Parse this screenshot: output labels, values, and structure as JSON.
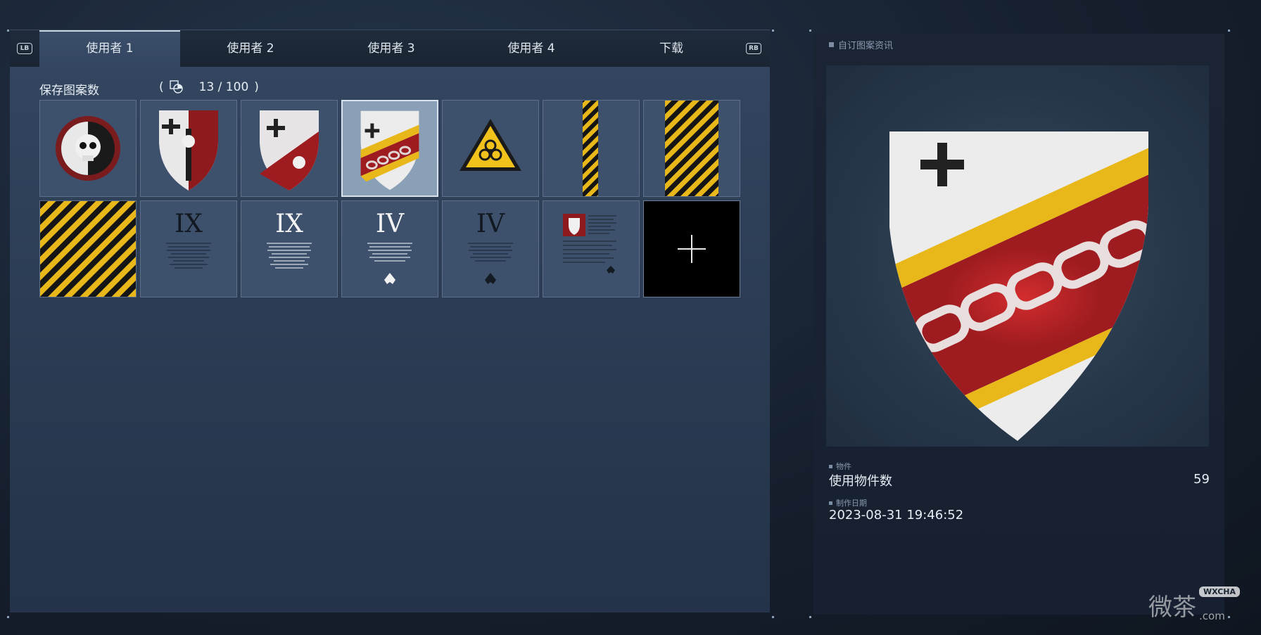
{
  "tabs": {
    "lb": "LB",
    "rb": "RB",
    "items": [
      "使用者 1",
      "使用者 2",
      "使用者 3",
      "使用者 4",
      "下载"
    ],
    "active_index": 0
  },
  "saved": {
    "label": "保存图案数",
    "open_paren": "(",
    "count": "13 / 100",
    "close_paren": ")"
  },
  "grid": {
    "items": [
      {
        "kind": "skull-gear-emblem"
      },
      {
        "kind": "shield-cross-skull"
      },
      {
        "kind": "shield-cross-red-skull"
      },
      {
        "kind": "shield-chain",
        "selected": true
      },
      {
        "kind": "biohazard-sign"
      },
      {
        "kind": "hazard-stripe-narrow"
      },
      {
        "kind": "hazard-stripe-medium"
      },
      {
        "kind": "hazard-stripe-square"
      },
      {
        "kind": "document",
        "numeral": "IX"
      },
      {
        "kind": "document",
        "numeral": "IX"
      },
      {
        "kind": "document",
        "numeral": "IV"
      },
      {
        "kind": "document",
        "numeral": "IV"
      },
      {
        "kind": "document-emblem"
      },
      {
        "kind": "add-new"
      }
    ]
  },
  "info": {
    "title": "自订图案资讯",
    "objects_section": "物件",
    "objects_label": "使用物件数",
    "objects_value": "59",
    "date_section": "制作日期",
    "date_value": "2023-08-31 19:46:52"
  },
  "watermark": {
    "text": "微茶",
    "badge": "WXCHA",
    "suffix": ".com"
  },
  "colors": {
    "accent_yellow": "#e8b81a",
    "accent_red": "#9e1c20",
    "panel": "#2c3d55"
  }
}
